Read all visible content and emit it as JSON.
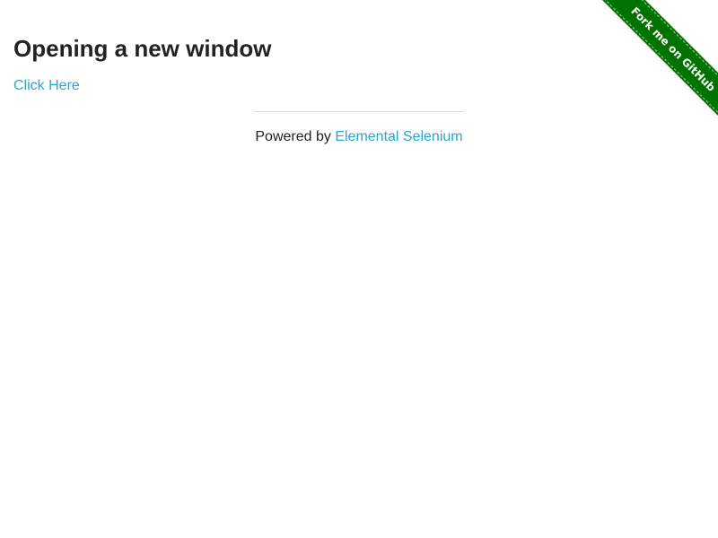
{
  "header": {
    "title": "Opening a new window"
  },
  "main": {
    "link_label": "Click Here"
  },
  "footer": {
    "powered_by_text": "Powered by ",
    "powered_by_link": "Elemental Selenium"
  },
  "ribbon": {
    "label": "Fork me on GitHub",
    "color": "#007200"
  },
  "colors": {
    "link": "#2ba6cb",
    "text": "#222222",
    "divider": "#dddddd"
  }
}
